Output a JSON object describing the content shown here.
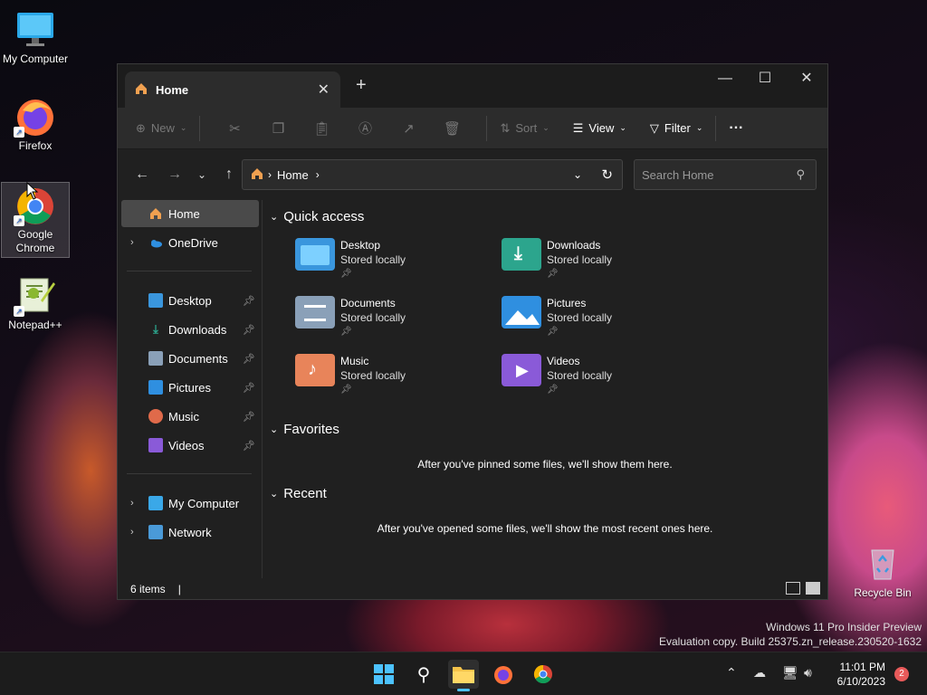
{
  "desktop": {
    "icons": [
      {
        "label": "My Computer",
        "icon": "computer-icon"
      },
      {
        "label": "Firefox",
        "icon": "firefox-icon"
      },
      {
        "label": "Google Chrome",
        "icon": "chrome-icon"
      },
      {
        "label": "Notepad++",
        "icon": "notepadpp-icon"
      }
    ],
    "recycle_bin": "Recycle Bin",
    "watermark_line1": "Windows 11 Pro Insider Preview",
    "watermark_line2": "Evaluation copy. Build 25375.zn_release.230520-1632"
  },
  "window": {
    "tab_title": "Home",
    "toolbar": {
      "new_label": "New",
      "sort_label": "Sort",
      "view_label": "View",
      "filter_label": "Filter",
      "more_label": "···"
    },
    "address": {
      "crumb": "Home"
    },
    "search": {
      "placeholder": "Search Home"
    },
    "sidebar": {
      "home": "Home",
      "onedrive": "OneDrive",
      "pinned": [
        {
          "label": "Desktop",
          "color": "#3a96dd"
        },
        {
          "label": "Downloads",
          "color": "#2ca58d"
        },
        {
          "label": "Documents",
          "color": "#8aa0b8"
        },
        {
          "label": "Pictures",
          "color": "#2f8fe0"
        },
        {
          "label": "Music",
          "color": "#e06a4a"
        },
        {
          "label": "Videos",
          "color": "#8a5ad8"
        }
      ],
      "my_computer": "My Computer",
      "network": "Network"
    },
    "quick_access": {
      "heading": "Quick access",
      "items": [
        {
          "name": "Desktop",
          "sub": "Stored locally",
          "color": "#3a96dd"
        },
        {
          "name": "Downloads",
          "sub": "Stored locally",
          "color": "#2ca58d"
        },
        {
          "name": "Documents",
          "sub": "Stored locally",
          "color": "#8aa0b8"
        },
        {
          "name": "Pictures",
          "sub": "Stored locally",
          "color": "#2f8fe0"
        },
        {
          "name": "Music",
          "sub": "Stored locally",
          "color": "#e8845a"
        },
        {
          "name": "Videos",
          "sub": "Stored locally",
          "color": "#8a5ad8"
        }
      ]
    },
    "favorites": {
      "heading": "Favorites",
      "empty": "After you've pinned some files, we'll show them here."
    },
    "recent": {
      "heading": "Recent",
      "empty": "After you've opened some files, we'll show the most recent ones here."
    },
    "status": {
      "count": "6 items"
    }
  },
  "taskbar": {
    "time": "11:01 PM",
    "date": "6/10/2023",
    "notifications": "2"
  }
}
